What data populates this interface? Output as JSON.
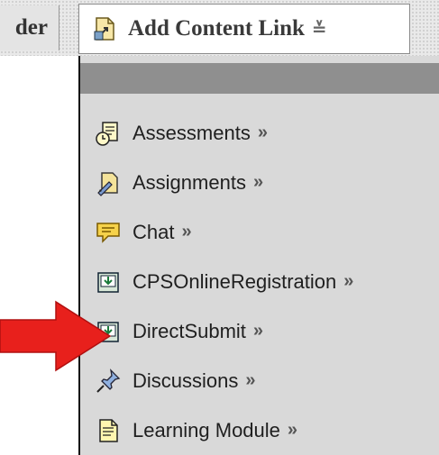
{
  "toolbar": {
    "prev_label": "der",
    "add_content_label": "Add Content Link",
    "add_content_icon": "content-link-icon",
    "dropdown_icon": "double-chevron-down-icon"
  },
  "menu": {
    "items": [
      {
        "label": "Assessments",
        "icon": "assessment-icon",
        "suffix": "»"
      },
      {
        "label": "Assignments",
        "icon": "assignment-icon",
        "suffix": "»"
      },
      {
        "label": "Chat",
        "icon": "chat-bubble-icon",
        "suffix": "»"
      },
      {
        "label": "CPSOnlineRegistration",
        "icon": "download-tray-icon",
        "suffix": "»"
      },
      {
        "label": "DirectSubmit",
        "icon": "download-tray-icon",
        "suffix": "»"
      },
      {
        "label": "Discussions",
        "icon": "pushpin-icon",
        "suffix": "»"
      },
      {
        "label": "Learning Module",
        "icon": "document-icon",
        "suffix": "»"
      }
    ]
  },
  "annotation": {
    "arrow_color": "#e8201c",
    "points_to": "DirectSubmit"
  }
}
